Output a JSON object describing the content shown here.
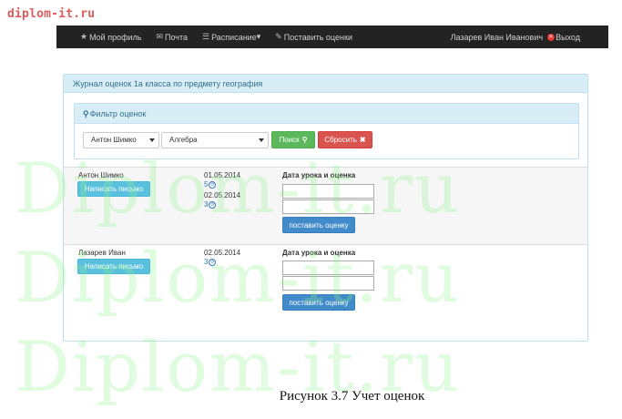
{
  "site_mark": "diplom-it.ru",
  "navbar": {
    "items": [
      {
        "icon": "star-icon",
        "glyph": "★",
        "label": "Мой профиль"
      },
      {
        "icon": "envelope-icon",
        "glyph": "✉",
        "label": "Почта"
      },
      {
        "icon": "list-icon",
        "glyph": "☰",
        "label": "Расписание"
      },
      {
        "icon": "pencil-icon",
        "glyph": "✎",
        "label": "Поставить оценки"
      }
    ],
    "schedule_caret": "▾",
    "user_name": "Лазарев Иван Иванович",
    "logout_label": "Выход"
  },
  "journal": {
    "title": "Журнал оценок 1а класса по предмету география",
    "filter": {
      "title": "Фильтр оценок",
      "student_selected": "Антон Шимко",
      "subject_selected": "Алгебра",
      "search_label": "Поиск",
      "reset_label": "Сбросить"
    },
    "rows": [
      {
        "name": "Антон Шимко",
        "mail_label": "Написать письмо",
        "grades": [
          {
            "date": "01.05.2014",
            "value": "5"
          },
          {
            "date": "02.05.2014",
            "value": "3"
          }
        ],
        "lesson_label": "Дата урока и оценка",
        "set_label": "поставить оценку"
      },
      {
        "name": "Лазарев Иван",
        "mail_label": "Написать письмо",
        "grades": [
          {
            "date": "02.05.2014",
            "value": "3"
          }
        ],
        "lesson_label": "Дата урока и оценка",
        "set_label": "поставить оценку"
      }
    ]
  },
  "watermark": "Diplom-it.ru",
  "caption": "Рисунок 3.7 Учет оценок",
  "colors": {
    "navbar_bg": "#232323",
    "panel_head": "#d9edf7",
    "search_button": "#5cb85c",
    "reset_button": "#d9534f",
    "mail_button": "#5bc0de",
    "set_button": "#428bca",
    "site_mark": "#e15b5b"
  }
}
